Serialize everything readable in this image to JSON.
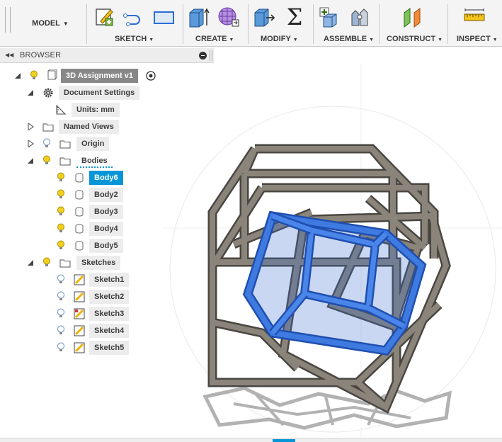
{
  "toolbar": {
    "workspace": {
      "label": "MODEL"
    },
    "groups": [
      {
        "label": "SKETCH"
      },
      {
        "label": "CREATE"
      },
      {
        "label": "MODIFY"
      },
      {
        "label": "ASSEMBLE"
      },
      {
        "label": "CONSTRUCT"
      },
      {
        "label": "INSPECT"
      }
    ],
    "sigma": "Σ"
  },
  "browser": {
    "title": "BROWSER",
    "root": {
      "label": "3D Assignment v1"
    },
    "document_settings": {
      "label": "Document Settings"
    },
    "units": {
      "label": "Units: mm"
    },
    "named_views": {
      "label": "Named Views"
    },
    "origin": {
      "label": "Origin"
    },
    "bodies": {
      "label": "Bodies",
      "items": [
        {
          "label": "Body6",
          "selected": true
        },
        {
          "label": "Body2"
        },
        {
          "label": "Body3"
        },
        {
          "label": "Body4"
        },
        {
          "label": "Body5"
        }
      ]
    },
    "sketches": {
      "label": "Sketches",
      "items": [
        {
          "label": "Sketch1"
        },
        {
          "label": "Sketch2"
        },
        {
          "label": "Sketch3"
        },
        {
          "label": "Sketch4"
        },
        {
          "label": "Sketch5"
        }
      ]
    }
  },
  "colors": {
    "selection": "#0696d7",
    "body_frame": "#6f6a63",
    "selected_body": "#2a63c9",
    "bulb_on": "#f2d022",
    "bulb_off": "#5d8dc7"
  }
}
